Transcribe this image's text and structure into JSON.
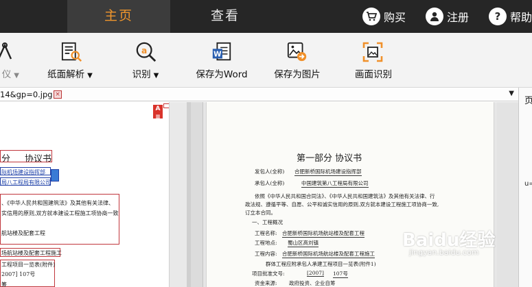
{
  "top_tabs": {
    "home": "主页",
    "view": "查看"
  },
  "top_actions": {
    "buy": "购买",
    "register": "注册",
    "help": "帮助"
  },
  "toolbar": {
    "partial": "仪",
    "paper_parse": "纸面解析",
    "recognize": "识别",
    "save_word": "保存为Word",
    "save_image": "保存为图片",
    "screen_ocr": "画面识别"
  },
  "document": {
    "tab_name": "14&gp=0.jpg"
  },
  "side_panel": {
    "tab": "页",
    "text": "u="
  },
  "scan": {
    "title": "第一部分      协议书",
    "employer_label": "发包人(全称)",
    "employer_value": "合肥新桥国际机场建设指挥部",
    "contractor_label": "承包人(全称)",
    "contractor_value": "中国建筑第八工程局有限公司",
    "para1": "依照《中华人民共和国合同法》、《中华人民共和国建筑法》及其他有关法律、行",
    "para2": "政法规、遵循平等、自愿、公平和诚实信用的原则,双方就本建设工程施工项协商一致,",
    "para3": "订立本合同。",
    "section1": "一、工程概况",
    "project_name_label": "工程名称:",
    "project_name": "合肥新桥国际机场航站楼及配套工程",
    "project_location_label": "工程地点:",
    "project_location": "蜀山区高刘镇",
    "project_content_label": "工程内容:",
    "project_content": "合肥新桥国际机场航站楼及配套工程施工",
    "list_line": "群体工程应附承包人承建工程项目一览表(附件1)",
    "approval_line": "项目批准文号:",
    "approval_year": "[2007]",
    "approval_num": "107号",
    "funding_label": "资金来源:",
    "funding_value": "政府投资、企业自筹"
  },
  "left_doc": {
    "title_a": "分",
    "title_b": "协议书",
    "line1": "际机场建设指挥部",
    "line2": "局八工程局有限公司",
    "para1": "、《中华人民共和国建筑法》及其他有关法律、",
    "para2": "实信用的原则,双方就本建设工程施工项协商一致",
    "line3": "航站楼及配套工程",
    "line4": "场航站楼及配套工程施工",
    "line5": "工程项目一览表(附件)",
    "line6": "2007] 107号",
    "line7": "筹"
  },
  "watermark": {
    "text": "Baidu经验",
    "sub": "jingyan.baidu.com"
  }
}
